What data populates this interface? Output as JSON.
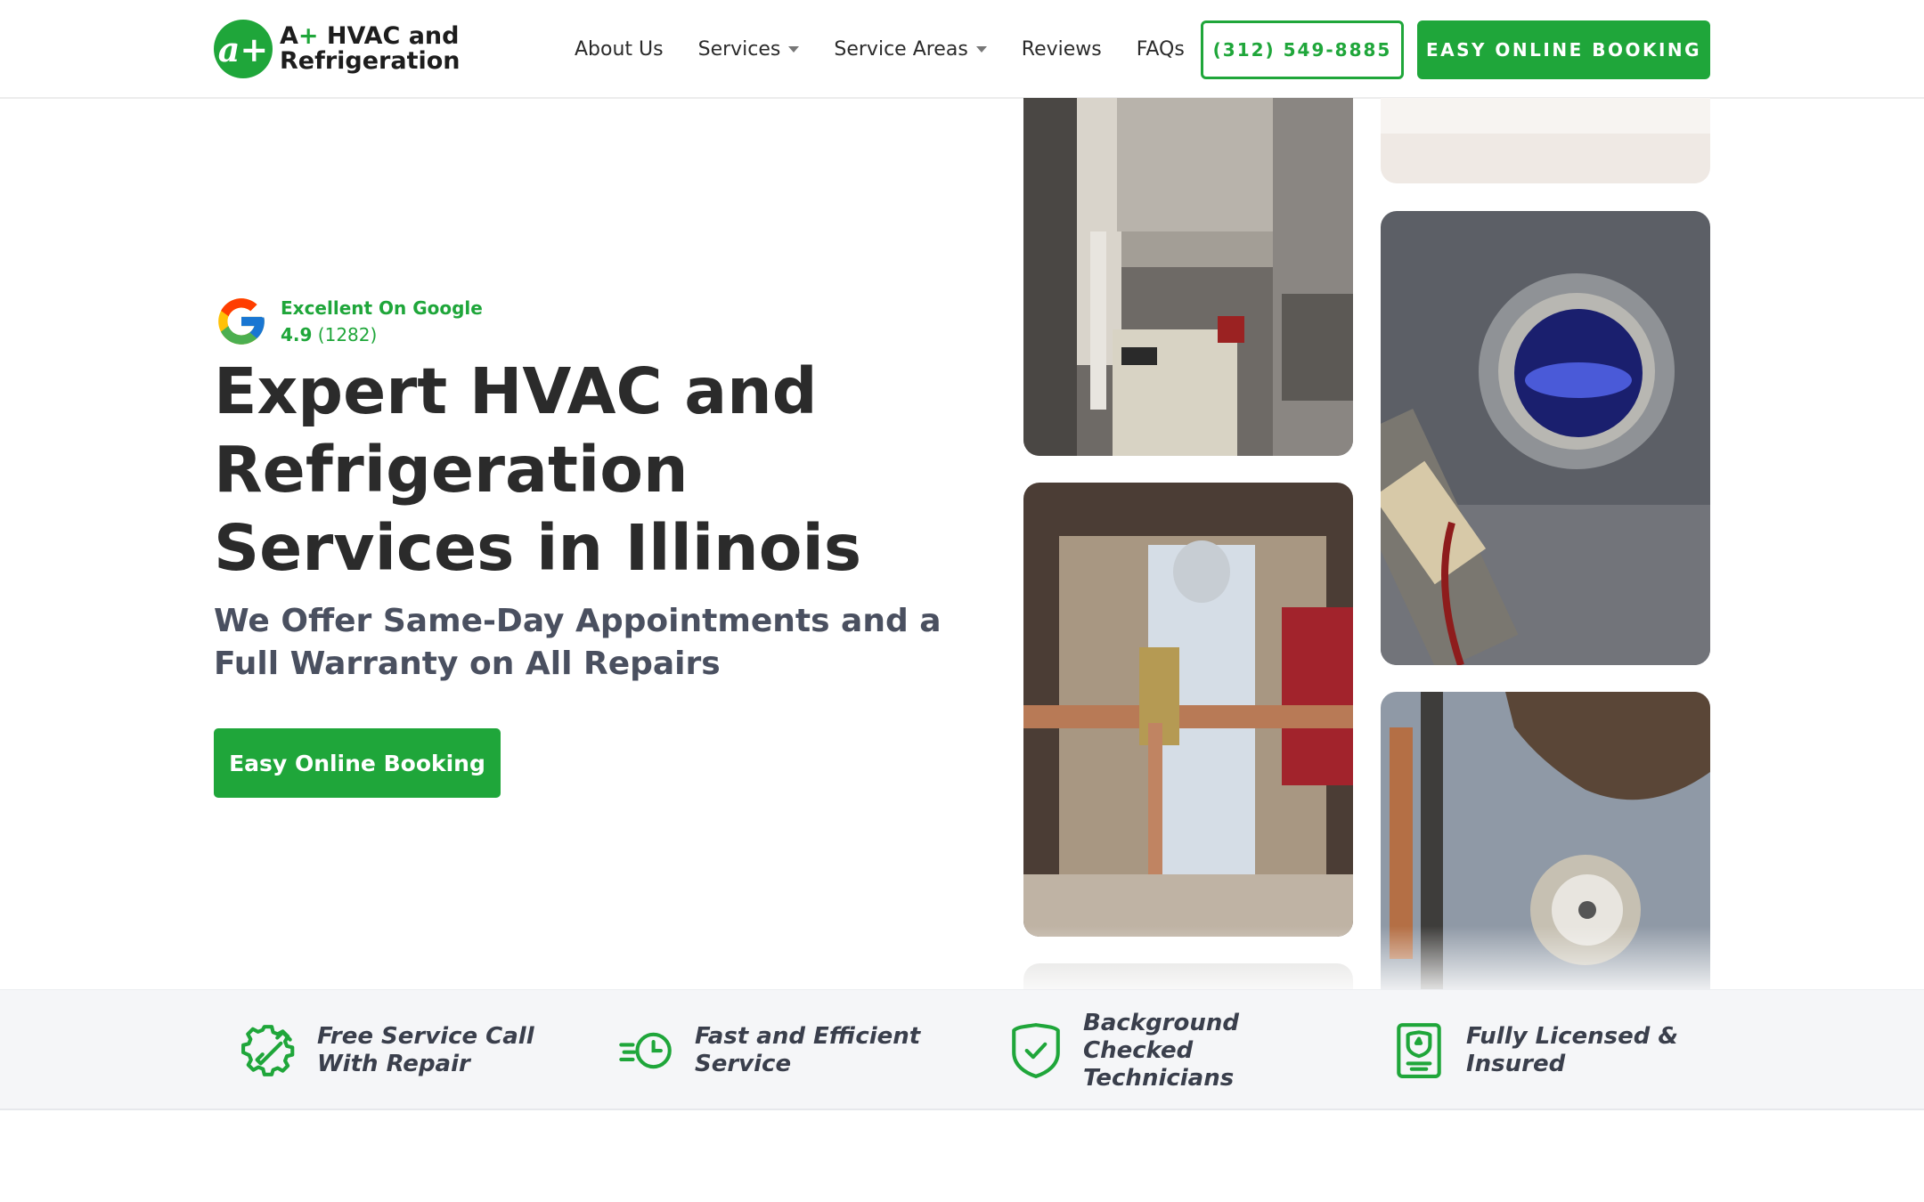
{
  "brand": {
    "logo_mark": "a+",
    "name_line1_prefix": "A",
    "name_line1_plus": "+",
    "name_line1_rest": " HVAC and",
    "name_line2": "Refrigeration"
  },
  "nav": {
    "about": "About Us",
    "services": "Services",
    "service_areas": "Service Areas",
    "reviews": "Reviews",
    "faqs": "FAQs"
  },
  "header": {
    "phone": "(312) 549-8885",
    "book_button": "EASY ONLINE BOOKING"
  },
  "google": {
    "label": "Excellent On Google",
    "rating": "4.9",
    "count": "(1282)",
    "icon": "google-g-icon"
  },
  "hero": {
    "title": "Expert HVAC and Refrigeration Services in Illinois",
    "subtitle": "We Offer Same-Day Appointments and a Full Warranty on All Repairs",
    "book_button": "Easy Online Booking"
  },
  "features": [
    {
      "icon": "gear-wrench-icon",
      "label": "Free Service Call With Repair"
    },
    {
      "icon": "fast-clock-icon",
      "label": "Fast and Efficient Service"
    },
    {
      "icon": "shield-check-icon",
      "label": "Background Checked Technicians"
    },
    {
      "icon": "license-badge-icon",
      "label": "Fully Licensed & Insured"
    }
  ],
  "colors": {
    "brand_green": "#1fa63a",
    "text_dark": "#2b2b2b",
    "subtitle": "#4a5060",
    "features_bg": "#f5f6f8"
  }
}
